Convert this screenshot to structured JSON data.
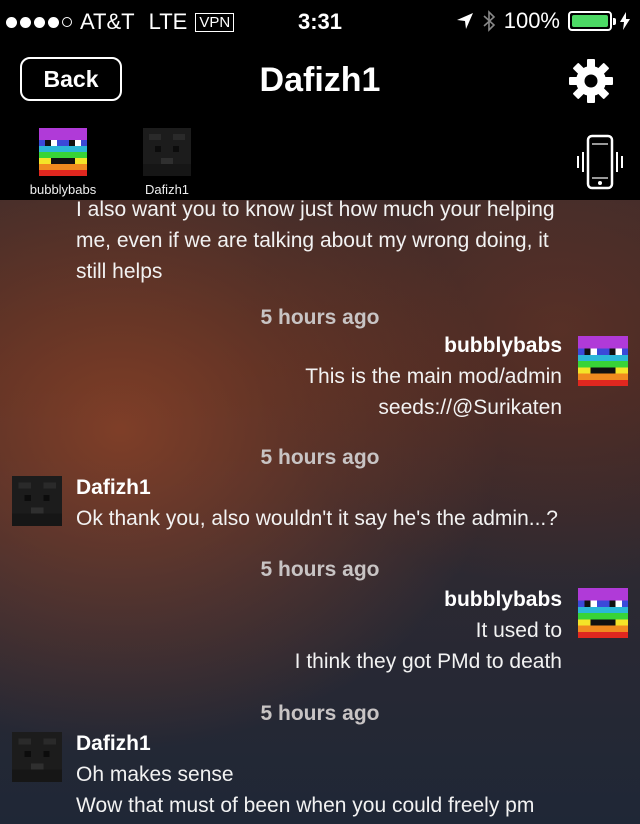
{
  "status_bar": {
    "carrier": "AT&T",
    "network": "LTE",
    "vpn": "VPN",
    "time": "3:31",
    "battery": "100%"
  },
  "nav": {
    "back_label": "Back",
    "title": "Dafizh1"
  },
  "participants": [
    {
      "name": "bubblybabs"
    },
    {
      "name": "Dafizh1"
    }
  ],
  "messages": {
    "m0": {
      "lines": [
        "I also want you to know just how much your helping",
        "me, even if we are talking about my wrong doing, it",
        "still helps"
      ]
    },
    "m1": {
      "time": "5 hours ago",
      "sender": "bubblybabs",
      "lines": [
        "This is the main mod/admin",
        "seeds://@Surikaten"
      ]
    },
    "m2": {
      "time": "5 hours ago",
      "sender": "Dafizh1",
      "lines": [
        "Ok thank you, also wouldn't it say he's the admin...?"
      ]
    },
    "m3": {
      "time": "5 hours ago",
      "sender": "bubblybabs",
      "lines": [
        "It used to",
        "I think they got PMd to death"
      ]
    },
    "m4": {
      "time": "5 hours ago",
      "sender": "Dafizh1",
      "lines": [
        "Oh makes sense",
        "Wow that must of been when you could freely pm"
      ]
    }
  }
}
